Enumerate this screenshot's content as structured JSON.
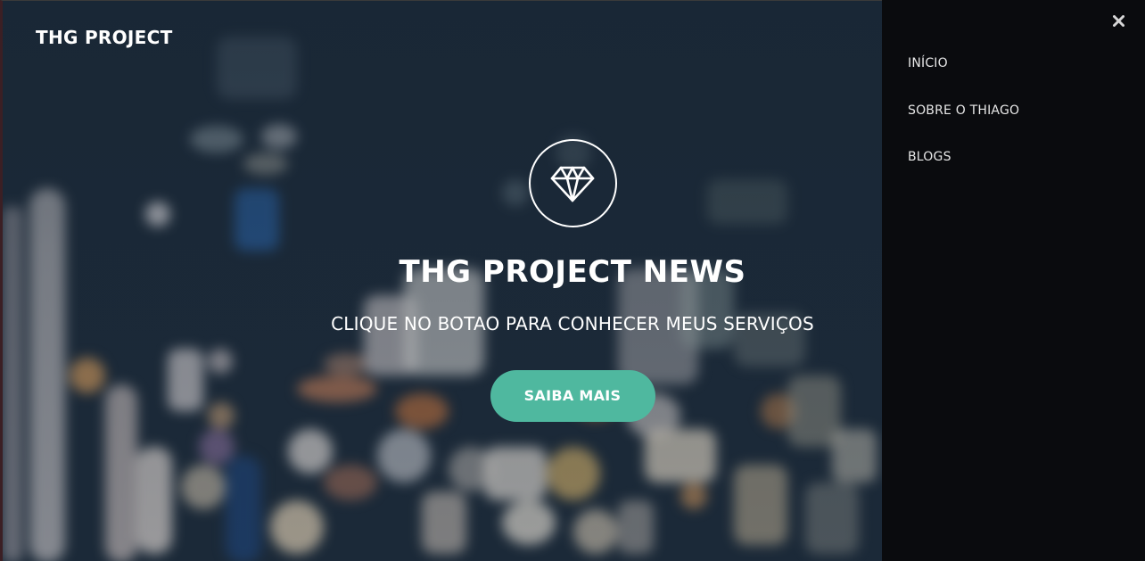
{
  "header": {
    "brand": "THG PROJECT"
  },
  "hero": {
    "icon": "diamond-icon",
    "title": "THG PROJECT NEWS",
    "subtitle": "CLIQUE NO BOTAO PARA CONHECER MEUS SERVIÇOS",
    "cta_label": "SAIBA MAIS"
  },
  "side_menu": {
    "close_icon": "close-icon",
    "items": [
      {
        "label": "INÍCIO"
      },
      {
        "label": "SOBRE O THIAGO"
      },
      {
        "label": "BLOGS"
      }
    ]
  },
  "colors": {
    "accent": "#4fb89f",
    "menu_background": "#0a0b0e",
    "hero_background": "#1d2b3a",
    "text": "#ffffff"
  }
}
